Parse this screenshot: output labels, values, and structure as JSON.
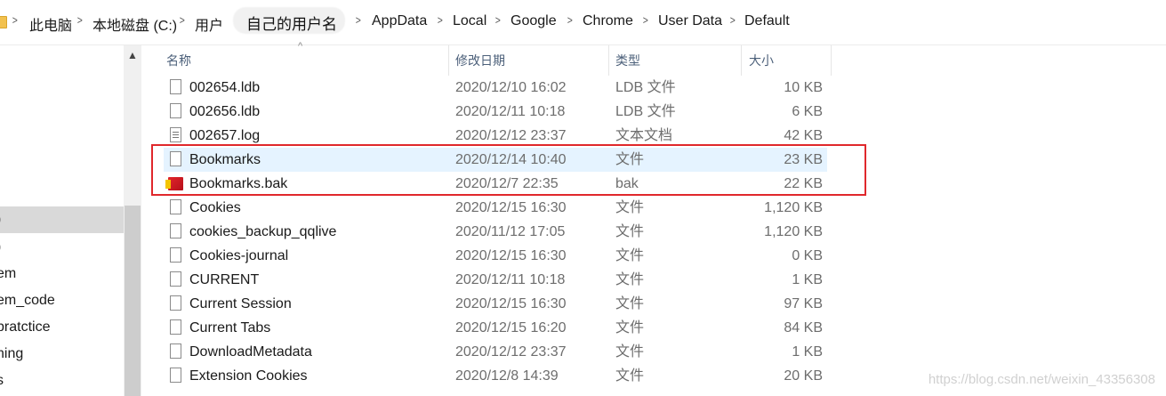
{
  "breadcrumb": {
    "items": [
      "此电脑",
      "本地磁盘 (C:)",
      "用户",
      "自己的用户名",
      "AppData",
      "Local",
      "Google",
      "Chrome",
      "User Data",
      "Default"
    ],
    "separator": ">"
  },
  "nav": {
    "items": [
      ")",
      ")",
      "em",
      "em_code",
      "pratctice",
      "ning",
      "s"
    ],
    "selected_index": 0
  },
  "columns": {
    "name": "名称",
    "date": "修改日期",
    "type": "类型",
    "size": "大小"
  },
  "files": [
    {
      "name": "002654.ldb",
      "date": "2020/12/10 16:02",
      "type": "LDB 文件",
      "size": "10 KB",
      "icon": "file-icon"
    },
    {
      "name": "002656.ldb",
      "date": "2020/12/11 10:18",
      "type": "LDB 文件",
      "size": "6 KB",
      "icon": "file-icon"
    },
    {
      "name": "002657.log",
      "date": "2020/12/12 23:37",
      "type": "文本文档",
      "size": "42 KB",
      "icon": "text-file-icon"
    },
    {
      "name": "Bookmarks",
      "date": "2020/12/14 10:40",
      "type": "文件",
      "size": "23 KB",
      "icon": "file-icon"
    },
    {
      "name": "Bookmarks.bak",
      "date": "2020/12/7 22:35",
      "type": "bak",
      "size": "22 KB",
      "icon": "archive-icon"
    },
    {
      "name": "Cookies",
      "date": "2020/12/15 16:30",
      "type": "文件",
      "size": "1,120 KB",
      "icon": "file-icon"
    },
    {
      "name": "cookies_backup_qqlive",
      "date": "2020/11/12 17:05",
      "type": "文件",
      "size": "1,120 KB",
      "icon": "file-icon"
    },
    {
      "name": "Cookies-journal",
      "date": "2020/12/15 16:30",
      "type": "文件",
      "size": "0 KB",
      "icon": "file-icon"
    },
    {
      "name": "CURRENT",
      "date": "2020/12/11 10:18",
      "type": "文件",
      "size": "1 KB",
      "icon": "file-icon"
    },
    {
      "name": "Current Session",
      "date": "2020/12/15 16:30",
      "type": "文件",
      "size": "97 KB",
      "icon": "file-icon"
    },
    {
      "name": "Current Tabs",
      "date": "2020/12/15 16:20",
      "type": "文件",
      "size": "84 KB",
      "icon": "file-icon"
    },
    {
      "name": "DownloadMetadata",
      "date": "2020/12/12 23:37",
      "type": "文件",
      "size": "1 KB",
      "icon": "file-icon"
    },
    {
      "name": "Extension Cookies",
      "date": "2020/12/8 14:39",
      "type": "文件",
      "size": "20 KB",
      "icon": "file-icon"
    }
  ],
  "selected_file_index": 3,
  "colors": {
    "highlight": "#e5f3ff",
    "annotation_box": "#e0282c",
    "header_text": "#4c607a"
  },
  "watermark": "https://blog.csdn.net/weixin_43356308"
}
